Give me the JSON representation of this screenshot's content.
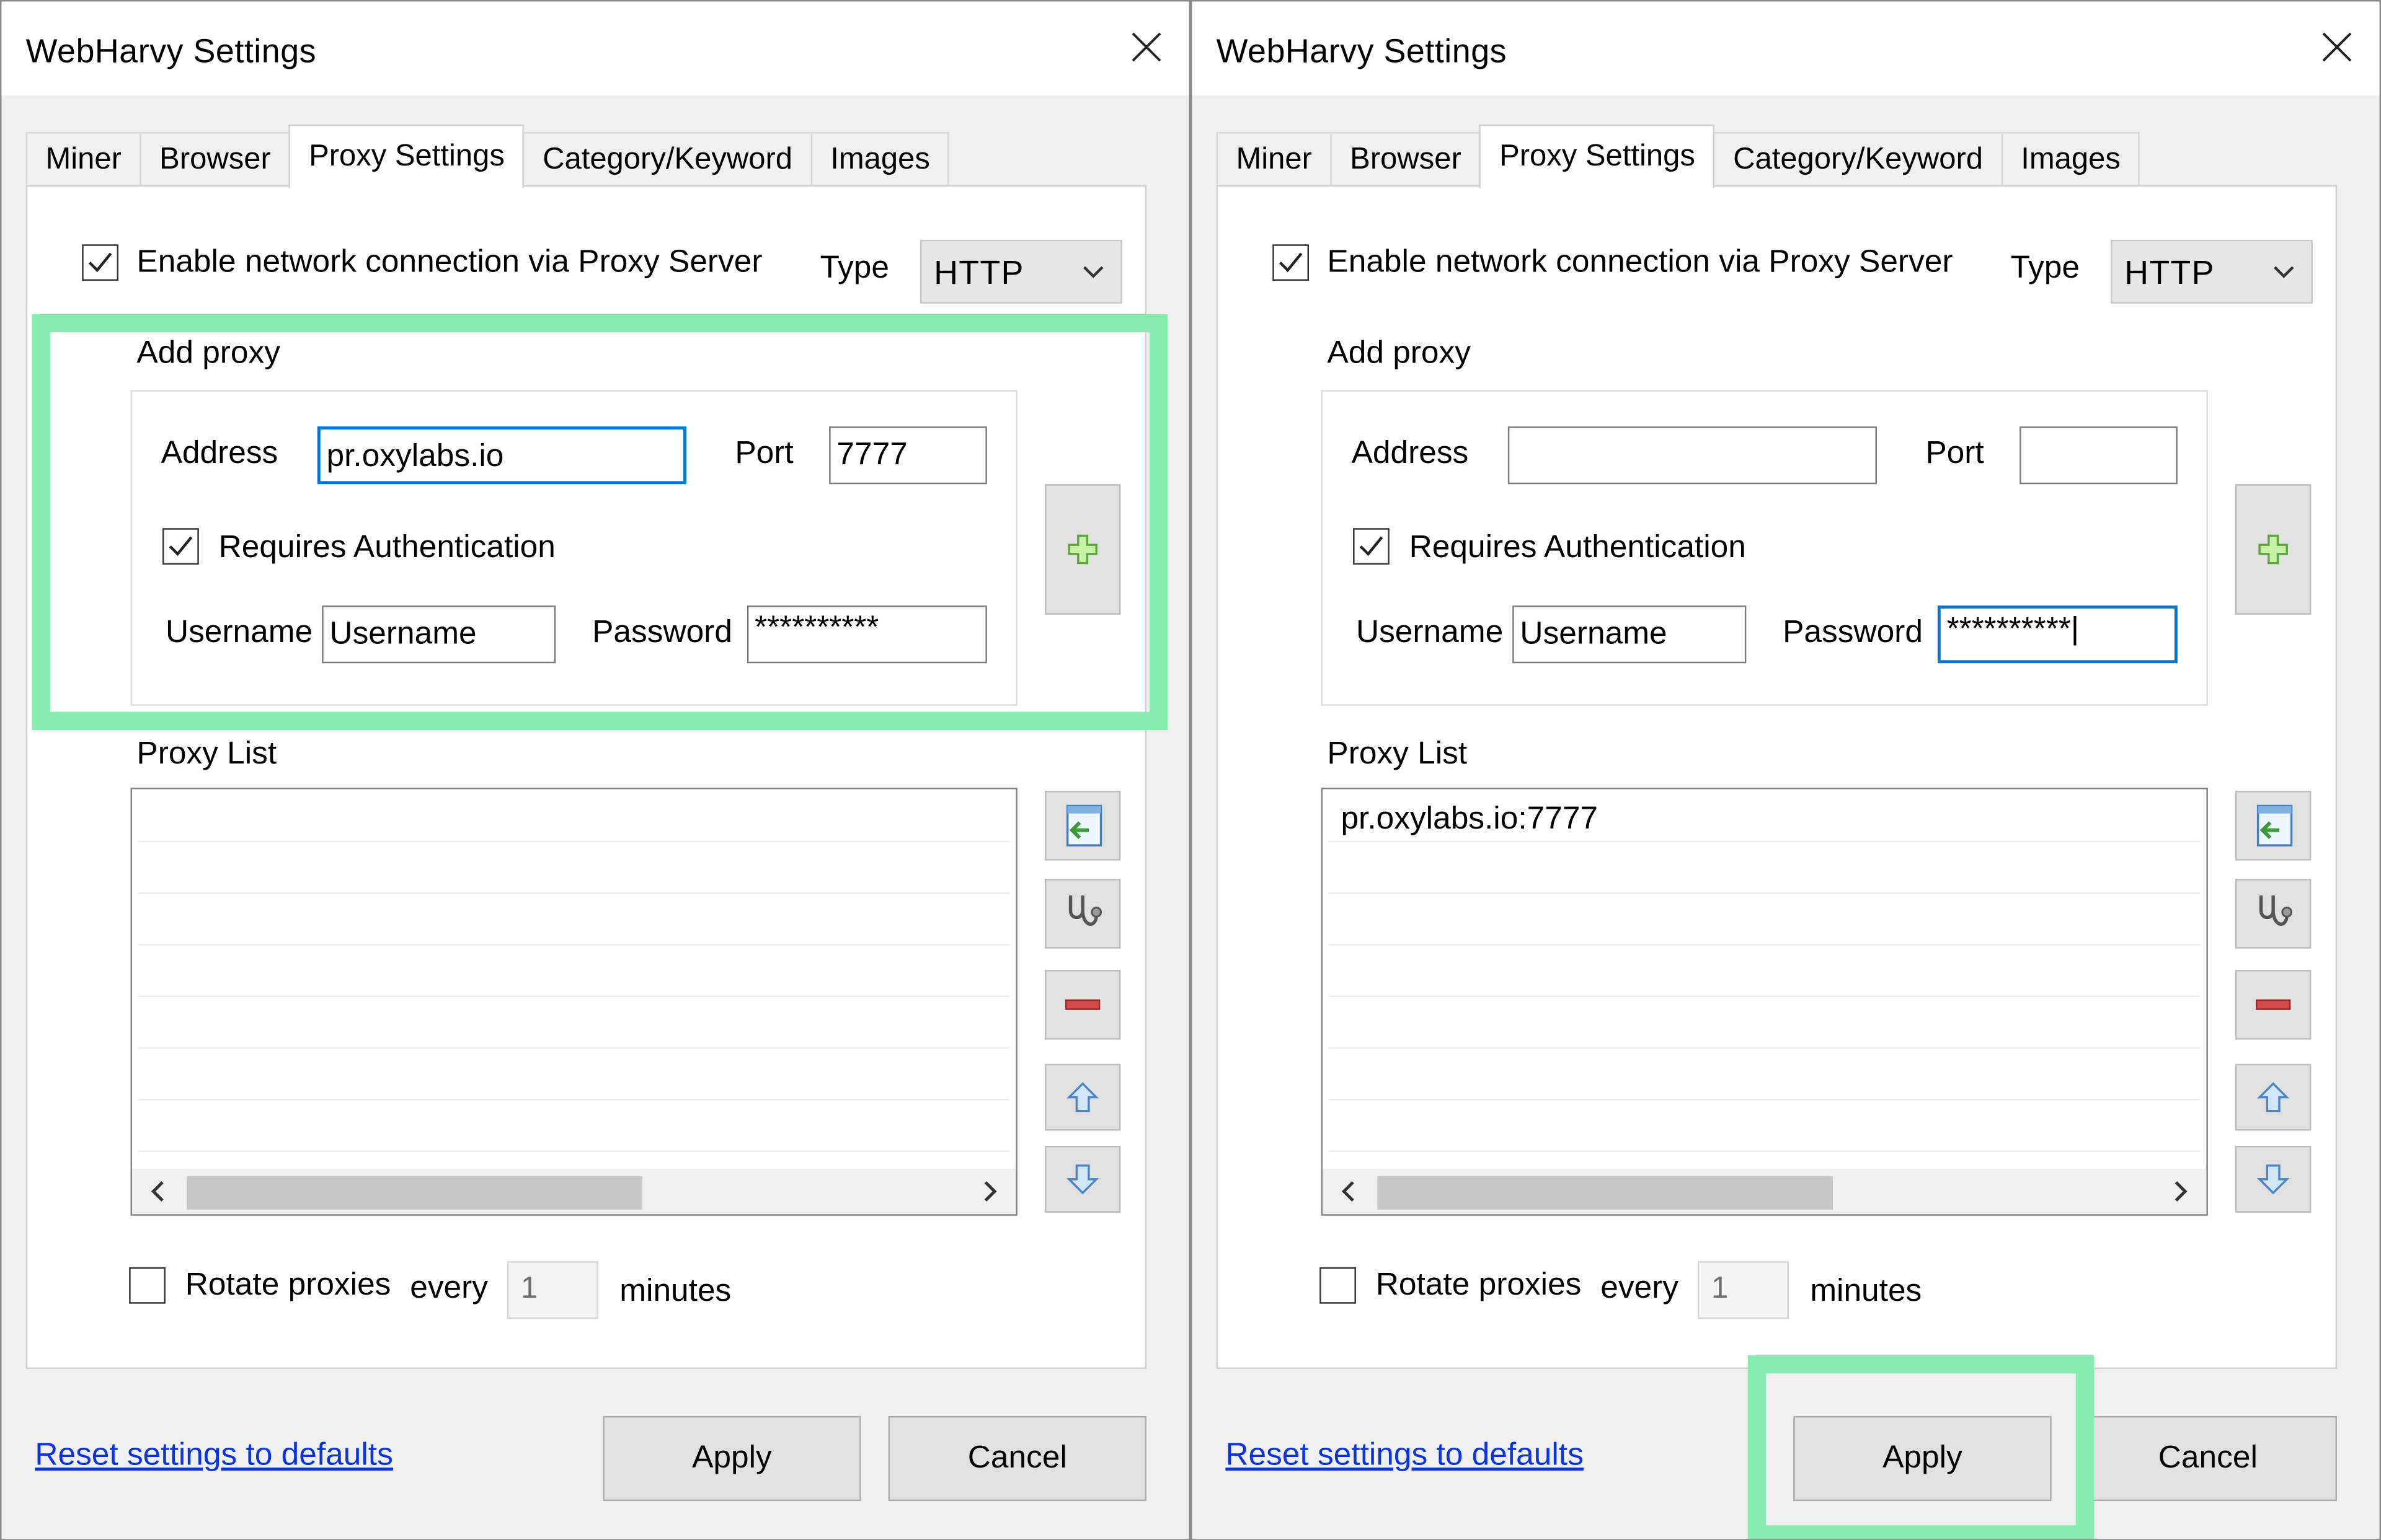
{
  "colors": {
    "highlight": "#86ecaf",
    "focus": "#0078d7",
    "link": "#0a33e6"
  },
  "left": {
    "title": "WebHarvy Settings",
    "tabs": [
      {
        "label": "Miner"
      },
      {
        "label": "Browser"
      },
      {
        "label": "Proxy Settings"
      },
      {
        "label": "Category/Keyword"
      },
      {
        "label": "Images"
      }
    ],
    "enable_proxy_label": "Enable network connection via Proxy Server",
    "type_label": "Type",
    "type_value": "HTTP",
    "add_proxy_label": "Add proxy",
    "address_label": "Address",
    "address_value": "pr.oxylabs.io",
    "port_label": "Port",
    "port_value": "7777",
    "requires_auth_label": "Requires Authentication",
    "username_label": "Username",
    "username_value": "Username",
    "password_label": "Password",
    "password_value": "**********",
    "proxy_list_label": "Proxy List",
    "proxy_list_items": [],
    "rotate_label": "Rotate proxies",
    "every_label": "every",
    "rotate_value": "1",
    "minutes_label": "minutes",
    "reset_link": "Reset settings to defaults",
    "apply_label": "Apply",
    "cancel_label": "Cancel"
  },
  "right": {
    "title": "WebHarvy Settings",
    "tabs": [
      {
        "label": "Miner"
      },
      {
        "label": "Browser"
      },
      {
        "label": "Proxy Settings"
      },
      {
        "label": "Category/Keyword"
      },
      {
        "label": "Images"
      }
    ],
    "enable_proxy_label": "Enable network connection via Proxy Server",
    "type_label": "Type",
    "type_value": "HTTP",
    "add_proxy_label": "Add proxy",
    "address_label": "Address",
    "address_value": "",
    "port_label": "Port",
    "port_value": "",
    "requires_auth_label": "Requires Authentication",
    "username_label": "Username",
    "username_value": "Username",
    "password_label": "Password",
    "password_value": "**********|",
    "proxy_list_label": "Proxy List",
    "proxy_list_items": [
      "pr.oxylabs.io:7777"
    ],
    "rotate_label": "Rotate proxies",
    "every_label": "every",
    "rotate_value": "1",
    "minutes_label": "minutes",
    "reset_link": "Reset settings to defaults",
    "apply_label": "Apply",
    "cancel_label": "Cancel"
  }
}
